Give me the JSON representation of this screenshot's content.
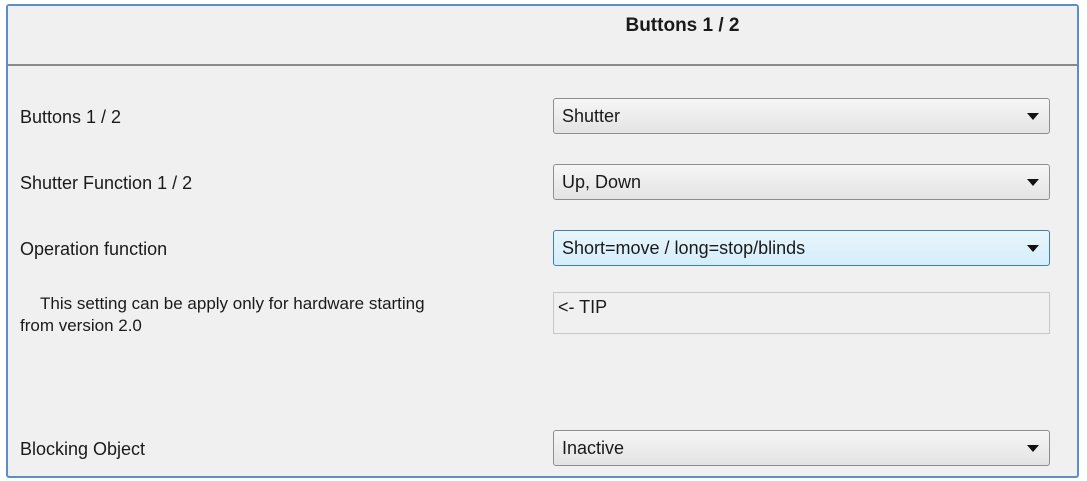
{
  "header": {
    "title": "Buttons 1 / 2"
  },
  "rows": {
    "buttons": {
      "label": "Buttons 1 / 2",
      "value": "Shutter"
    },
    "shutter_function": {
      "label": "Shutter Function 1 / 2",
      "value": "Up, Down"
    },
    "operation_function": {
      "label": "Operation function",
      "value": "Short=move / long=stop/blinds"
    },
    "note": {
      "line1": "This setting can be apply only for hardware starting",
      "line2": "from version 2.0",
      "tip": "<- TIP"
    },
    "blocking_object": {
      "label": "Blocking Object",
      "value": "Inactive"
    }
  },
  "icons": {
    "dropdown": "chevron-down-icon"
  },
  "colors": {
    "frame_border": "#5b8fc7",
    "focus_border": "#3c7fb1",
    "panel_bg": "#f0f0f0"
  }
}
